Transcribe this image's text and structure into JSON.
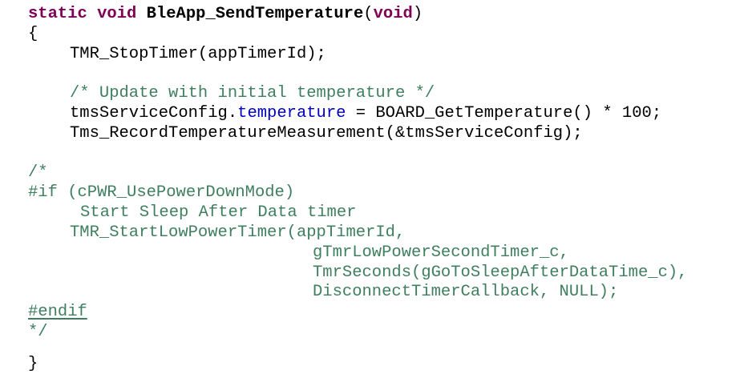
{
  "code": {
    "l1": {
      "kw1": "static void",
      "fname": "BleApp_SendTemperature",
      "paren_open": "(",
      "kw2": "void",
      "paren_close": ")"
    },
    "l2": "{",
    "l3": "TMR_StopTimer(appTimerId);",
    "l5": "/* Update with initial temperature */",
    "l6": {
      "prefix": "tmsServiceConfig.",
      "field": "temperature",
      "rest": " = BOARD_GetTemperature() * 100;"
    },
    "l7": "Tms_RecordTemperatureMeasurement(&tmsServiceConfig);",
    "l9": "/*",
    "l10": "#if (cPWR_UsePowerDownMode)",
    "l11": "Start Sleep After Data timer",
    "l12": "TMR_StartLowPowerTimer(appTimerId,",
    "l13": "gTmrLowPowerSecondTimer_c,",
    "l14": "TmrSeconds(gGoToSleepAfterDataTime_c),",
    "l15": "DisconnectTimerCallback, NULL);",
    "l16": "#endif",
    "l17": "*/",
    "l19": "}"
  },
  "colors": {
    "keyword": "#7f0055",
    "comment": "#3f7f5f",
    "field": "#0000c0",
    "text": "#000000",
    "background": "#ffffff"
  }
}
